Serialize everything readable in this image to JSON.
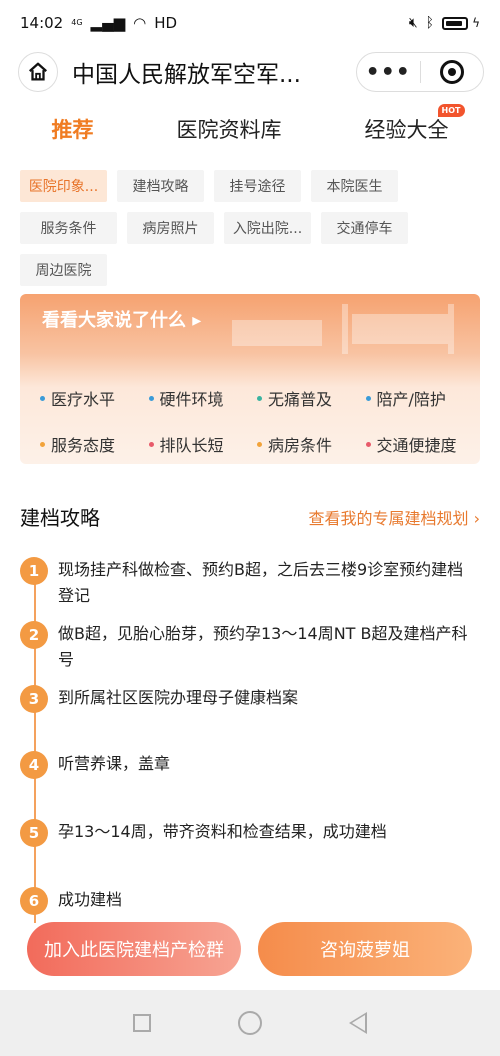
{
  "status_bar": {
    "time": "14:02",
    "network": "4G",
    "network_type": "HD",
    "icons": [
      "signal-icon",
      "wifi-icon",
      "mute-icon",
      "bluetooth-icon",
      "battery-icon",
      "charging-icon"
    ]
  },
  "title_bar": {
    "title": "中国人民解放军空军...",
    "home_icon": "home-icon",
    "more_label": "•••"
  },
  "main_tabs": [
    {
      "label": "推荐",
      "active": true
    },
    {
      "label": "医院资料库",
      "active": false
    },
    {
      "label": "经验大全",
      "active": false,
      "badge": "HOT"
    }
  ],
  "chips": [
    {
      "label": "医院印象...",
      "active": true
    },
    {
      "label": "建档攻略",
      "active": false
    },
    {
      "label": "挂号途径",
      "active": false
    },
    {
      "label": "本院医生",
      "active": false
    },
    {
      "label": "服务条件",
      "active": false
    },
    {
      "label": "病房照片",
      "active": false
    },
    {
      "label": "入院出院...",
      "active": false
    },
    {
      "label": "交通停车",
      "active": false
    },
    {
      "label": "周边医院",
      "active": false
    }
  ],
  "banner": {
    "title": "看看大家说了什么",
    "tags": [
      {
        "label": "医疗水平",
        "color": "#3a9bd8"
      },
      {
        "label": "硬件环境",
        "color": "#3a9bd8"
      },
      {
        "label": "无痛普及",
        "color": "#3ab3a0"
      },
      {
        "label": "陪产/陪护",
        "color": "#3a9bd8"
      },
      {
        "label": "服务态度",
        "color": "#f2a33a"
      },
      {
        "label": "排队长短",
        "color": "#e85a6a"
      },
      {
        "label": "病房条件",
        "color": "#f2a33a"
      },
      {
        "label": "交通便捷度",
        "color": "#e85a6a"
      }
    ]
  },
  "section": {
    "title": "建档攻略",
    "link": "查看我的专属建档规划 ›"
  },
  "steps": [
    {
      "num": "1",
      "text": "现场挂产科做检查、预约B超，之后去三楼9诊室预约建档登记"
    },
    {
      "num": "2",
      "text": "做B超，见胎心胎芽，预约孕13～14周NT B超及建档产科号"
    },
    {
      "num": "3",
      "text": "到所属社区医院办理母子健康档案"
    },
    {
      "num": "4",
      "text": "听营养课，盖章"
    },
    {
      "num": "5",
      "text": "孕13～14周，带齐资料和检查结果，成功建档"
    },
    {
      "num": "6",
      "text": "成功建档"
    }
  ],
  "buttons": {
    "join": "加入此医院建档产检群",
    "consult": "咨询菠萝姐"
  },
  "colors": {
    "accent": "#f07c22",
    "step": "#f39a43"
  }
}
